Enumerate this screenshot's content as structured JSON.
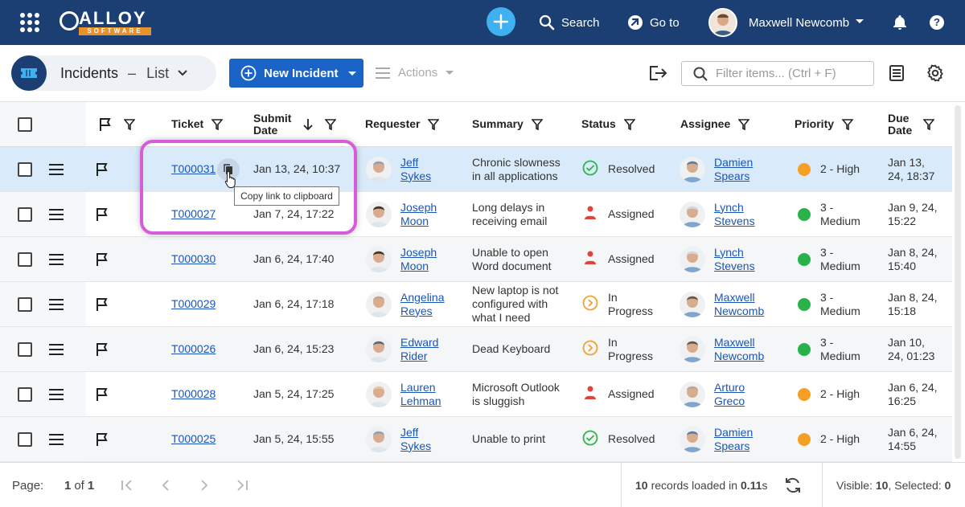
{
  "topbar": {
    "logo_text": "ALLOY",
    "logo_sub": "SOFTWARE",
    "search_label": "Search",
    "goto_label": "Go to",
    "user_name": "Maxwell Newcomb"
  },
  "toolbar": {
    "title": "Incidents",
    "dash": "–",
    "view": "List",
    "new_label": "New Incident",
    "actions_label": "Actions",
    "filter_placeholder": "Filter items... (Ctrl + F)"
  },
  "columns": {
    "ticket": "Ticket",
    "submit_line1": "Submit",
    "submit_line2": "Date",
    "requester": "Requester",
    "summary": "Summary",
    "status": "Status",
    "assignee": "Assignee",
    "priority": "Priority",
    "due_line1": "Due",
    "due_line2": "Date"
  },
  "rows": [
    {
      "ticket": "T000031",
      "submit": "Jan 13, 24, 10:37",
      "req1": "Jeff",
      "req2": "Sykes",
      "summary": "Chronic slowness in all applications",
      "status1": "Resolved",
      "status2": "",
      "asg1": "Damien",
      "asg2": "Spears",
      "prio1": "2 - High",
      "prio2": "",
      "due1": "Jan 13,",
      "due2": "24, 18:37"
    },
    {
      "ticket": "T000027",
      "submit": "Jan 7, 24, 17:22",
      "req1": "Joseph",
      "req2": "Moon",
      "summary": "Long delays in receiving email",
      "status1": "Assigned",
      "status2": "",
      "asg1": "Lynch",
      "asg2": "Stevens",
      "prio1": "3 -",
      "prio2": "Medium",
      "due1": "Jan 9, 24,",
      "due2": "15:22"
    },
    {
      "ticket": "T000030",
      "submit": "Jan 6, 24, 17:40",
      "req1": "Joseph",
      "req2": "Moon",
      "summary": "Unable to open Word document",
      "status1": "Assigned",
      "status2": "",
      "asg1": "Lynch",
      "asg2": "Stevens",
      "prio1": "3 -",
      "prio2": "Medium",
      "due1": "Jan 8, 24,",
      "due2": "15:40"
    },
    {
      "ticket": "T000029",
      "submit": "Jan 6, 24, 17:18",
      "req1": "Angelina",
      "req2": "Reyes",
      "summary": "New laptop is not configured with what I need",
      "status1": "In",
      "status2": "Progress",
      "asg1": "Maxwell",
      "asg2": "Newcomb",
      "prio1": "3 -",
      "prio2": "Medium",
      "due1": "Jan 8, 24,",
      "due2": "15:18"
    },
    {
      "ticket": "T000026",
      "submit": "Jan 6, 24, 15:23",
      "req1": "Edward",
      "req2": "Rider",
      "summary": "Dead Keyboard",
      "status1": "In",
      "status2": "Progress",
      "asg1": "Maxwell",
      "asg2": "Newcomb",
      "prio1": "3 -",
      "prio2": "Medium",
      "due1": "Jan 10,",
      "due2": "24, 01:23"
    },
    {
      "ticket": "T000028",
      "submit": "Jan 5, 24, 17:25",
      "req1": "Lauren",
      "req2": "Lehman",
      "summary": "Microsoft Outlook is sluggish",
      "status1": "Assigned",
      "status2": "",
      "asg1": "Arturo",
      "asg2": "Greco",
      "prio1": "2 - High",
      "prio2": "",
      "due1": "Jan 6, 24,",
      "due2": "16:25"
    },
    {
      "ticket": "T000025",
      "submit": "Jan 5, 24, 15:55",
      "req1": "Jeff",
      "req2": "Sykes",
      "summary": "Unable to print",
      "status1": "Resolved",
      "status2": "",
      "asg1": "Damien",
      "asg2": "Spears",
      "prio1": "2 - High",
      "prio2": "",
      "due1": "Jan 6, 24,",
      "due2": "14:55"
    }
  ],
  "tooltip": "Copy link to clipboard",
  "footer": {
    "page_label": "Page:",
    "page_current": "1",
    "page_of": "of",
    "page_total": "1",
    "records_count": "10",
    "records_text": "records loaded in",
    "records_time": "0.11",
    "records_unit": "s",
    "visible_label": "Visible:",
    "visible_count": "10",
    "selected_label": "Selected:",
    "selected_count": "0"
  },
  "colors": {
    "topbar": "#1c3f73",
    "accent": "#1a63c7",
    "resolved": "#2db34a",
    "assigned": "#e0443a",
    "in_progress": "#f0a030",
    "priority_high": "#f5a023",
    "priority_medium": "#27b34a",
    "highlight": "#d65cdc"
  }
}
